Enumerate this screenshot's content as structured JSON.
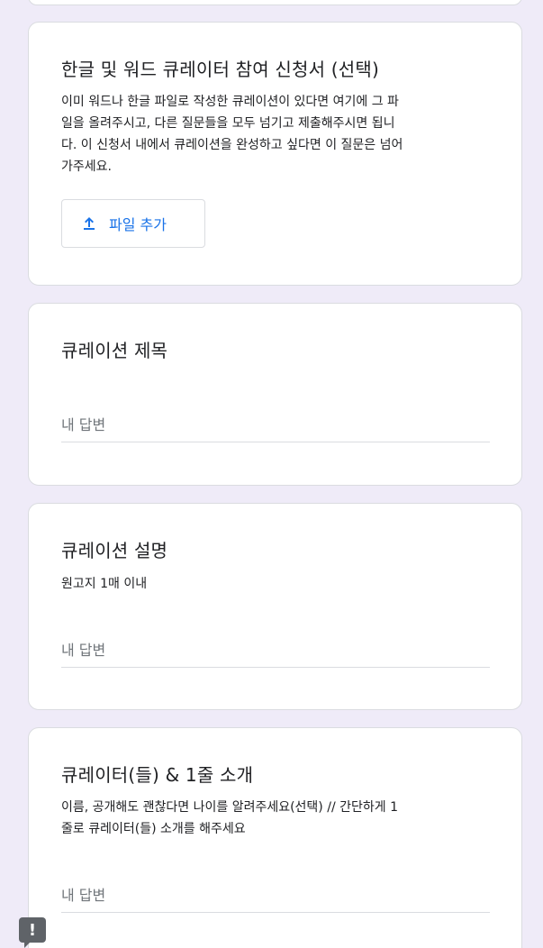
{
  "upload_section": {
    "title": "한글 및 워드 큐레이터 참여 신청서 (선택)",
    "help_lines": [
      "이미 워드나 한글 파일로 작성한 큐레이션이 있다면 여기에 그 파",
      "일을 올려주시고, 다른 질문들을 모두 넘기고 제출해주시면 됩니",
      "다. 이 신청서 내에서 큐레이션을 완성하고 싶다면 이 질문은 넘어",
      "가주세요."
    ],
    "button_label": "파일 추가",
    "button_icon": "upload-icon"
  },
  "curation_title": {
    "title": "큐레이션 제목",
    "placeholder": "내 답변"
  },
  "curation_description": {
    "title": "큐레이션 설명",
    "help": "원고지 1매 이내",
    "placeholder": "내 답변"
  },
  "curator_intro": {
    "title": "큐레이터(들) & 1줄 소개",
    "help_lines": [
      "이름, 공개해도 괜찮다면 나이를 알려주세요(선택) // 간단하게 1",
      "줄로 큐레이터(들) 소개를 해주세요"
    ],
    "placeholder": "내 답변"
  },
  "feedback_button": {
    "icon": "feedback-icon",
    "glyph": "!"
  },
  "colors": {
    "background": "#efebf8",
    "card": "#ffffff",
    "accent": "#1a73e8",
    "border": "#dadce0"
  }
}
